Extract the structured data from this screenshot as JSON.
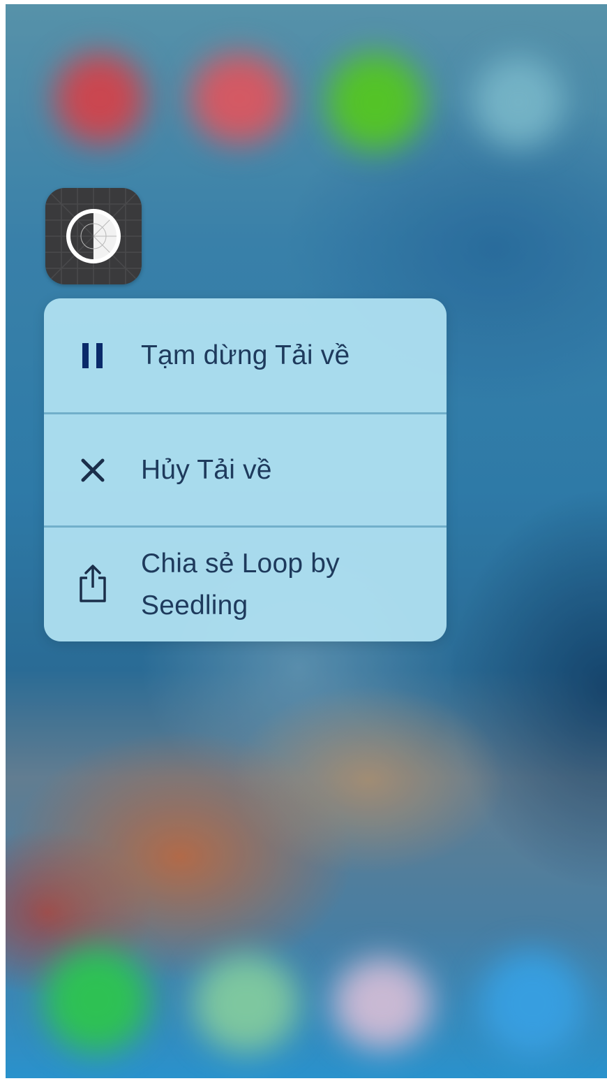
{
  "app": {
    "icon_name": "loop-by-seedling-app-icon"
  },
  "quick_actions": {
    "items": [
      {
        "label": "Tạm dừng Tải về",
        "icon": "pause-icon"
      },
      {
        "label": "Hủy Tải về",
        "icon": "close-icon"
      },
      {
        "label": "Chia sẻ Loop by Seedling",
        "icon": "share-icon"
      }
    ]
  },
  "colors": {
    "menu_background": "#b2e2f2",
    "menu_text": "#1e3a5c",
    "pause_icon": "#0a2a6a",
    "app_icon_background": "#3a3a3c"
  }
}
